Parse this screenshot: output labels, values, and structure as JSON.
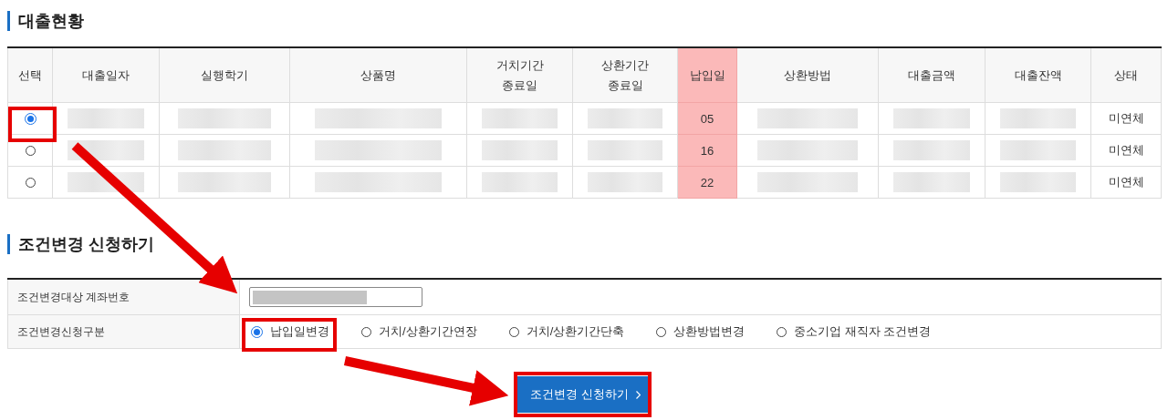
{
  "loan_status": {
    "title": "대출현황",
    "columns": [
      {
        "label": "선택",
        "kind": "select",
        "highlighted": false
      },
      {
        "label": "대출일자",
        "kind": "redacted",
        "highlighted": false
      },
      {
        "label": "실행학기",
        "kind": "redacted",
        "highlighted": false
      },
      {
        "label": "상품명",
        "kind": "redacted",
        "highlighted": false
      },
      {
        "label": "거치기간\n종료일",
        "kind": "redacted",
        "highlighted": false
      },
      {
        "label": "상환기간\n종료일",
        "kind": "redacted",
        "highlighted": false
      },
      {
        "label": "납입일",
        "kind": "payment_day",
        "highlighted": true
      },
      {
        "label": "상환방법",
        "kind": "redacted",
        "highlighted": false
      },
      {
        "label": "대출금액",
        "kind": "redacted",
        "highlighted": false
      },
      {
        "label": "대출잔액",
        "kind": "redacted",
        "highlighted": false
      },
      {
        "label": "상태",
        "kind": "status",
        "highlighted": false
      }
    ],
    "rows": [
      {
        "selected": true,
        "payment_day": "05",
        "status": "미연체"
      },
      {
        "selected": false,
        "payment_day": "16",
        "status": "미연체"
      },
      {
        "selected": false,
        "payment_day": "22",
        "status": "미연체"
      }
    ]
  },
  "change_request": {
    "title": "조건변경 신청하기",
    "fields": [
      {
        "label": "조건변경대상 계좌번호",
        "kind": "account"
      },
      {
        "label": "조건변경신청구분",
        "kind": "options",
        "options": [
          {
            "label": "납입일변경",
            "selected": true
          },
          {
            "label": "거치/상환기간연장",
            "selected": false
          },
          {
            "label": "거치/상환기간단축",
            "selected": false
          },
          {
            "label": "상환방법변경",
            "selected": false
          },
          {
            "label": "중소기업 재직자 조건변경",
            "selected": false
          }
        ]
      }
    ],
    "submit_button": "조건변경 신청하기"
  }
}
